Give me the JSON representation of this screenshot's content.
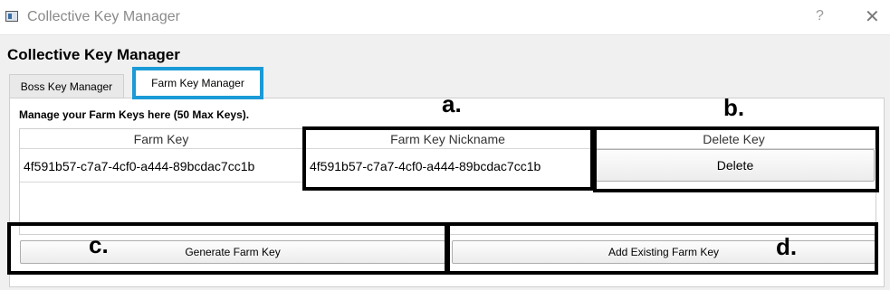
{
  "window": {
    "title": "Collective Key Manager",
    "help_label": "?",
    "close_label": "✕"
  },
  "page_title": "Collective Key Manager",
  "tabs": [
    {
      "label": "Boss Key Manager",
      "active": false
    },
    {
      "label": "Farm Key Manager",
      "active": true
    }
  ],
  "manage_label": "Manage your Farm Keys here (50 Max Keys).",
  "table": {
    "columns": [
      "Farm Key",
      "Farm Key Nickname",
      "Delete Key"
    ],
    "rows": [
      {
        "farm_key": "4f591b57-c7a7-4cf0-a444-89bcdac7cc1b",
        "nickname": "4f591b57-c7a7-4cf0-a444-89bcdac7cc1b",
        "delete_label": "Delete"
      }
    ]
  },
  "buttons": {
    "generate": "Generate Farm Key",
    "add_existing": "Add Existing Farm Key"
  },
  "callouts": {
    "a": "a.",
    "b": "b.",
    "c": "c.",
    "d": "d."
  },
  "colors": {
    "tab_highlight": "#1a9ad6",
    "annotation_border": "#000000"
  },
  "icons": {
    "app": "app-window-icon",
    "help": "help-icon",
    "close": "close-icon"
  }
}
